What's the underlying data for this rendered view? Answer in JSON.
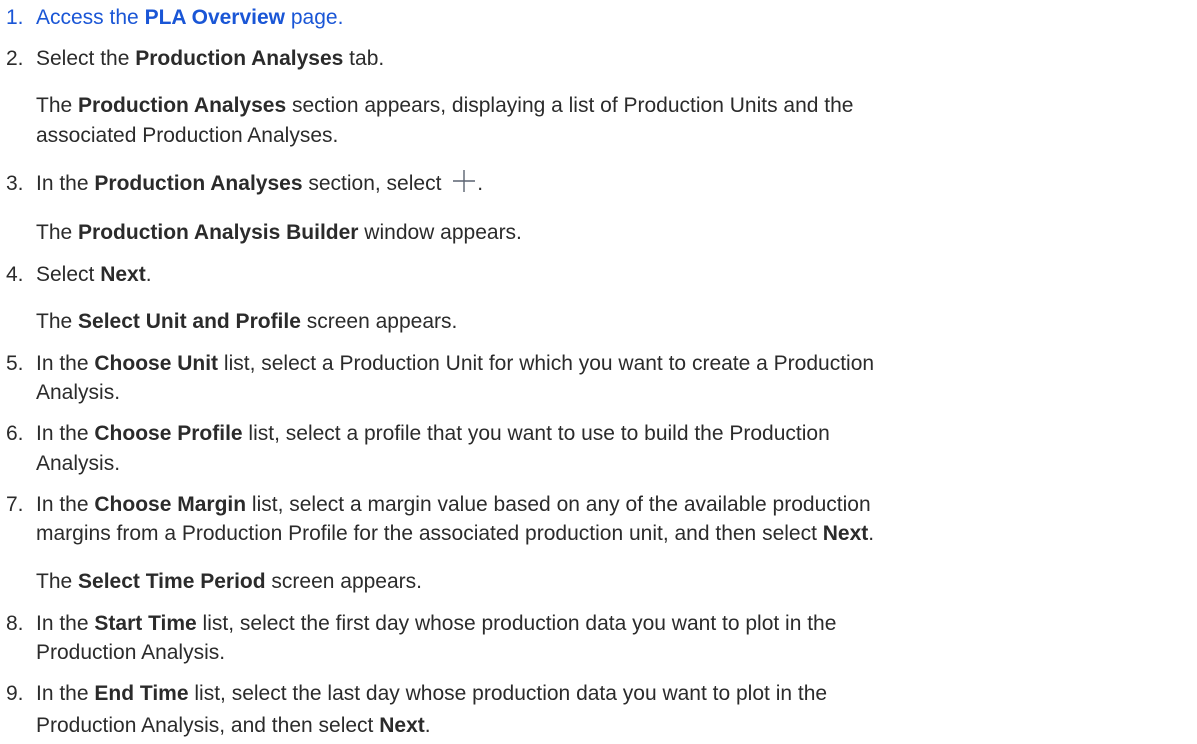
{
  "steps": [
    {
      "num": "1.",
      "pre": "Access the ",
      "b1": "PLA Overview",
      "post": " page."
    },
    {
      "num": "2.",
      "pre": "Select the ",
      "b1": "Production Analyses",
      "post": " tab."
    },
    {
      "note2a_pre": "The ",
      "note2a_b": "Production Analyses",
      "note2a_post": " section appears, displaying a list of Production Units and the",
      "note2b": "associated Production Analyses."
    },
    {
      "num": "3.",
      "pre": "In the ",
      "b1": "Production Analyses",
      "post": " section, select ",
      "post2": "."
    },
    {
      "note_pre": "The ",
      "note_b": "Production Analysis Builder",
      "note_post": " window appears."
    },
    {
      "num": "4.",
      "pre": "Select ",
      "b1": "Next",
      "post": "."
    },
    {
      "note_pre": "The ",
      "note_b": "Select Unit and Profile",
      "note_post": " screen appears."
    },
    {
      "num": "5.",
      "pre": "In the ",
      "b1": "Choose Unit",
      "post": " list, select a Production Unit for which you want to create a Production",
      "cont": "Analysis."
    },
    {
      "num": "6.",
      "pre": "In the ",
      "b1": "Choose Profile",
      "post": " list, select a profile that you want to use to build the Production",
      "cont": "Analysis."
    },
    {
      "num": "7.",
      "pre": "In the ",
      "b1": "Choose Margin",
      "post": " list, select a margin value based on any of the available production",
      "cont_pre": "margins from a Production Profile for the associated production unit, and then select ",
      "cont_b": "Next",
      "cont_post": "."
    },
    {
      "note_pre": "The ",
      "note_b": "Select Time Period",
      "note_post": " screen appears."
    },
    {
      "num": "8.",
      "pre": "In the ",
      "b1": "Start Time",
      "post": " list, select the first day whose production data you want to plot in the",
      "cont": "Production Analysis."
    },
    {
      "num": "9.",
      "pre": "In the ",
      "b1": "End Time",
      "post": " list, select the last day whose production data you want to plot in the",
      "cont_pre": "Production Analysis, and then select ",
      "cont_b": "Next",
      "cont_post": "."
    }
  ],
  "icons": {
    "add": "plus-icon"
  },
  "colors": {
    "link": "#1a56d6",
    "text": "#2b2b2b"
  }
}
